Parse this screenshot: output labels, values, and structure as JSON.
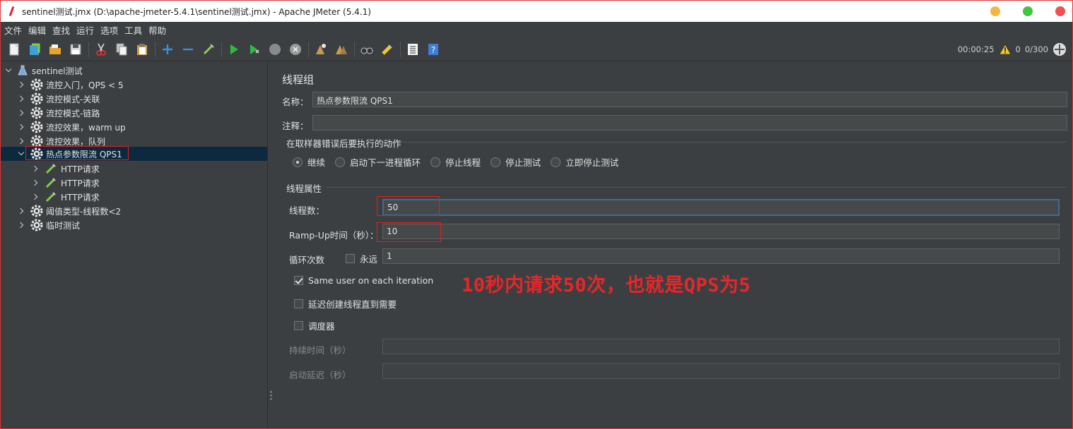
{
  "window": {
    "title": "sentinel测试.jmx (D:\\apache-jmeter-5.4.1\\sentinel测试.jmx) - Apache JMeter (5.4.1)"
  },
  "menu": [
    "文件",
    "编辑",
    "查找",
    "运行",
    "选项",
    "工具",
    "帮助"
  ],
  "status": {
    "elapsed": "00:00:25",
    "warnings": "0",
    "threads": "0/300"
  },
  "tree": {
    "root": "sentinel测试",
    "items": [
      {
        "label": "流控入门，QPS < 5"
      },
      {
        "label": "流控模式-关联"
      },
      {
        "label": "流控模式-链路"
      },
      {
        "label": "流控效果，warm up"
      },
      {
        "label": "流控效果，队列"
      },
      {
        "label": "热点参数限流 QPS1"
      },
      {
        "label": "HTTP请求"
      },
      {
        "label": "HTTP请求"
      },
      {
        "label": "HTTP请求"
      },
      {
        "label": "阈值类型-线程数<2"
      },
      {
        "label": "临时测试"
      }
    ]
  },
  "panel": {
    "title": "线程组",
    "name_label": "名称：",
    "name_value": "热点参数限流 QPS1",
    "comment_label": "注释：",
    "comment_value": "",
    "on_error_section": "在取样器错误后要执行的动作",
    "on_error_options": [
      "继续",
      "启动下一进程循环",
      "停止线程",
      "停止测试",
      "立即停止测试"
    ],
    "thread_props_section": "线程属性",
    "threads_label": "线程数：",
    "threads_value": "50",
    "rampup_label": "Ramp-Up时间（秒）：",
    "rampup_value": "10",
    "loop_label": "循环次数",
    "forever_label": "永远",
    "loop_value": "1",
    "same_user_label": "Same user on each iteration",
    "delay_create_label": "延迟创建线程直到需要",
    "scheduler_label": "调度器",
    "duration_label": "持续时间（秒）",
    "startup_delay_label": "启动延迟（秒）"
  },
  "annotation": "10秒内请求50次，也就是QPS为5",
  "colors": {
    "background": "#3c3f41",
    "selection": "#0d293e",
    "highlight_box": "#e02020",
    "annotation": "#e8262a"
  }
}
